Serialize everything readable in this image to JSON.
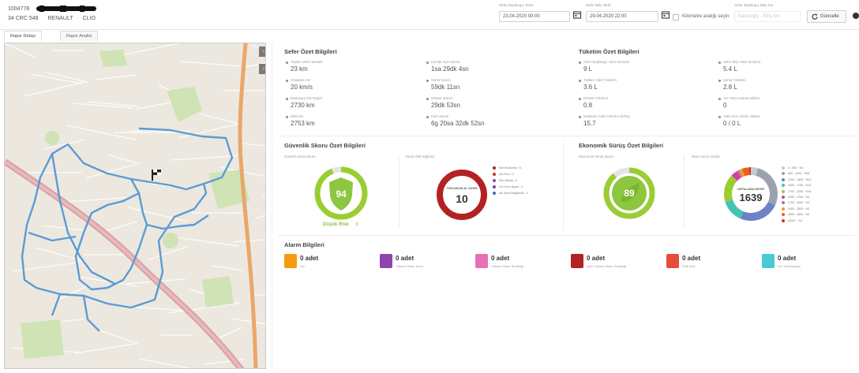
{
  "header": {
    "vehicle_id": "1004778",
    "plate": "34 CRC 548",
    "brand": "RENAULT",
    "model": "CLIO",
    "start_label": "Sefer Başlangıç Tarihi",
    "start_value": "23.04.2020 00:00",
    "end_label": "Sefer Bitiş Tarihi",
    "end_value": "29.04.2020 22:00",
    "km_check_label": "Kilometre aralığı seçin",
    "km_range_label": "Sefer Başlangıç Bitiş Km",
    "km_range_placeholder": "Başlangıç - Bitiş km",
    "refresh_label": "Güncelle"
  },
  "tabs": [
    "Rapor Detayı",
    "Rapor Analizi"
  ],
  "trip_summary": {
    "title": "Sefer Özet Bilgileri",
    "items": [
      {
        "label": "Toplam Sefer Mesafe",
        "value": "23 km"
      },
      {
        "label": "Ortalama Hız",
        "value": "20 km/s"
      },
      {
        "label": "Başlangıç KM Değeri",
        "value": "2730 km"
      },
      {
        "label": "Bitiş KM",
        "value": "2753 km"
      },
      {
        "label": "Kontak Açık Süresi",
        "value": "1sa 29dk 4sn"
      },
      {
        "label": "Sürüş Süresi",
        "value": "59dk 11sn"
      },
      {
        "label": "Rölanti Süresi",
        "value": "29dk 53sn"
      },
      {
        "label": "Park Süresi",
        "value": "6g 20sa 32dk 52sn"
      }
    ]
  },
  "consumption_summary": {
    "title": "Tüketim Özet Bilgileri",
    "items": [
      {
        "label": "Sefer Başlangıç Yakıt Seviyesi",
        "value": "9 L"
      },
      {
        "label": "Toplam Yakıt Tüketimi",
        "value": "3.6 L"
      },
      {
        "label": "Rölanti Tüketimi",
        "value": "0.8"
      },
      {
        "label": "Ortalama Yakıt Tüketimi (lt/km)",
        "value": "15.7"
      },
      {
        "label": "Sefer Bitiş Yakıt Seviyesi",
        "value": "5.4 L"
      },
      {
        "label": "Sürüş Tüketimi",
        "value": "2.8 L"
      },
      {
        "label": "Anı Yakıt Azalma Miktarı",
        "value": "0"
      },
      {
        "label": "Yakıt Alım Adedi / Miktarı",
        "value": "0 / 0 L"
      }
    ]
  },
  "safety": {
    "title": "Güvenlik Skoru Özet Bilgileri",
    "score_label": "Güvenli Sürüş Skoru",
    "score": "94",
    "score_fraction": 0.94,
    "risk_text": "Düşük Risk",
    "events_label": "Sürüş Ihlal Dağılımı",
    "events_center_label": "TOPLAM IHLAL SAYISI",
    "events_total": "10",
    "legend": [
      {
        "label": "Sert Hızlanma : 6",
        "color": "#b22222"
      },
      {
        "label": "Ani Fren : 0",
        "color": "#c0392b"
      },
      {
        "label": "Sert Dönüş : 0",
        "color": "#8e44ad"
      },
      {
        "label": "Hız Sınırı Aşımı : 4",
        "color": "#7b3fa0"
      },
      {
        "label": "Ani Şerit Değiştirme : 0",
        "color": "#2e6fbf"
      }
    ]
  },
  "eco": {
    "title": "Ekonomik Sürüş Özet Bilgileri",
    "score_label": "Ekonomik Sürüş Skoru",
    "score": "89",
    "score_fraction": 0.89,
    "rpm_label": "Motor Devri Analizi",
    "rpm_center_label": "ORTALAMA DEVİR",
    "rpm_value": "1639",
    "legend": [
      {
        "label": "0 - 800 : %4",
        "color": "#c9c9c9"
      },
      {
        "label": "800 - 1200 : %26",
        "color": "#9aa3ad"
      },
      {
        "label": "1200 - 1500 : %23",
        "color": "#6c84c4"
      },
      {
        "label": "1500 - 1750 : %13",
        "color": "#45c2b8"
      },
      {
        "label": "1750 - 2250 : %16",
        "color": "#9acd32"
      },
      {
        "label": "2250 - 2750 : %4",
        "color": "#d33fa3"
      },
      {
        "label": "2750 - 3000 : %1",
        "color": "#b26cc4"
      },
      {
        "label": "3000 - 3500 : %2",
        "color": "#f39c12"
      },
      {
        "label": "3500 - 4000 : %4",
        "color": "#e45f2b"
      },
      {
        "label": "4000+ : %1",
        "color": "#c0392b"
      }
    ]
  },
  "alarms": {
    "title": "Alarm Bilgileri",
    "items": [
      {
        "count": "0 adet",
        "name": "Hız",
        "color": "#f39c12"
      },
      {
        "count": "0 adet",
        "name": "Yüksek Motor Devri",
        "color": "#8e44ad"
      },
      {
        "count": "0 adet",
        "name": "Yüksek Motor Sıcaklığı",
        "color": "#e86fb4"
      },
      {
        "count": "0 adet",
        "name": "Aşırı Yüksek Motor Sıcaklığı",
        "color": "#b22222"
      },
      {
        "count": "0 adet",
        "name": "Park Dışı",
        "color": "#e74c3c"
      },
      {
        "count": "0 adet",
        "name": "Anı Yakıt Azalışı",
        "color": "#48c9d4"
      }
    ]
  }
}
